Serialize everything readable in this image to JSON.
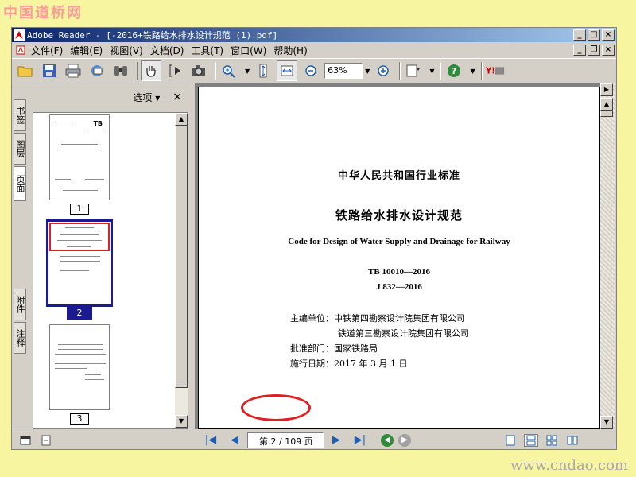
{
  "watermarks": {
    "top": "中国道桥网",
    "bottom": "www.cndao.com"
  },
  "window": {
    "title": "Adobe Reader - [-2016+铁路给水排水设计规范 (1).pdf]",
    "controls": [
      "_",
      "□",
      "×"
    ],
    "doc_controls": [
      "_",
      "❐",
      "×"
    ]
  },
  "menu": {
    "items": [
      "文件(F)",
      "编辑(E)",
      "视图(V)",
      "文档(D)",
      "工具(T)",
      "窗口(W)",
      "帮助(H)"
    ]
  },
  "toolbar": {
    "zoom_value": "63%",
    "icons": [
      "open-folder-icon",
      "save-icon",
      "print-icon",
      "email-icon",
      "search-binoculars-icon",
      "hand-tool-icon",
      "select-text-icon",
      "snapshot-icon",
      "zoom-in-tool-icon",
      "fit-height-icon",
      "fit-width-icon",
      "zoom-out-icon",
      "zoom-in-icon",
      "create-pdf-icon",
      "help-icon",
      "yahoo-icon"
    ]
  },
  "side_tabs": [
    "书签",
    "图层",
    "页面",
    "附件",
    "注释"
  ],
  "nav_panel": {
    "options_label": "选项",
    "close_label": "×",
    "thumbnails": [
      {
        "label": "1",
        "selected": false
      },
      {
        "label": "2",
        "selected": true
      },
      {
        "label": "3",
        "selected": false
      }
    ]
  },
  "page": {
    "standard_line": "中华人民共和国行业标准",
    "cn_title": "铁路给水排水设计规范",
    "en_title": "Code for Design of Water Supply and Drainage for Railway",
    "code1": "TB 10010—2016",
    "code2": "J 832—2016",
    "editor_label": "主编单位：",
    "editor1": "中铁第四勘察设计院集团有限公司",
    "editor2": "铁道第三勘察设计院集团有限公司",
    "approver_label": "批准部门：",
    "approver": "国家铁路局",
    "effective_label": "施行日期：",
    "effective": "2017 年 3 月 1 日"
  },
  "statusbar": {
    "page_indicator": "第 2 / 109 页"
  },
  "colors": {
    "title_start": "#0a246a",
    "title_end": "#a6caf0",
    "chrome": "#d4d0c8",
    "selection": "#1b1b8f",
    "highlight_ellipse": "#e02020"
  }
}
